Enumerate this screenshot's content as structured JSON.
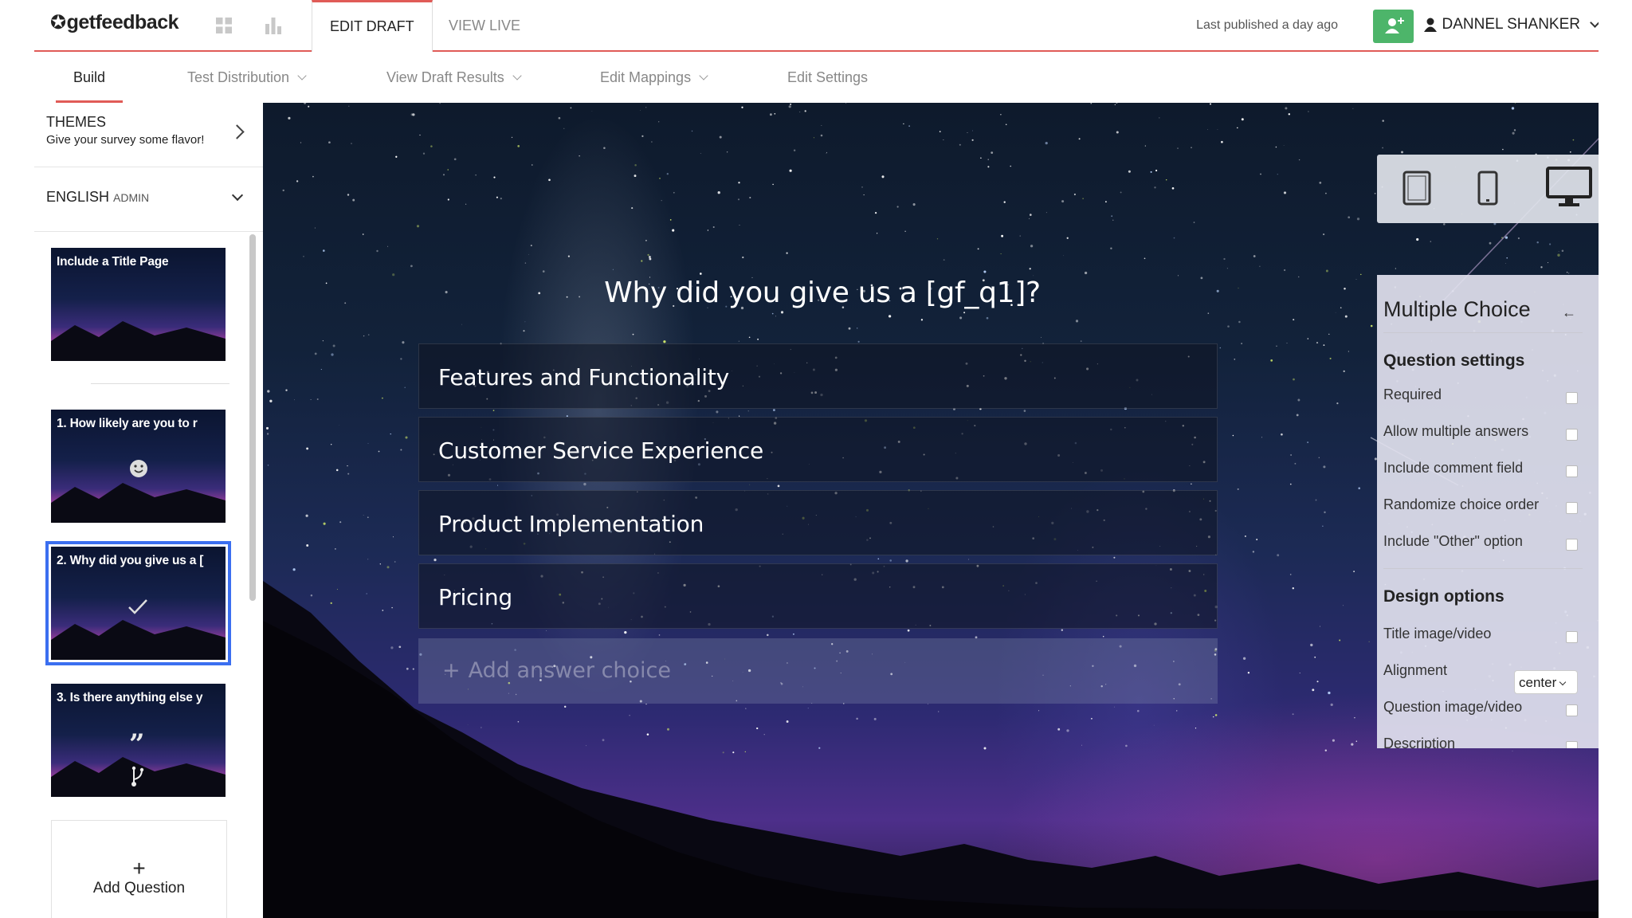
{
  "brand": {
    "logo_text": "getfeedback"
  },
  "topbar": {
    "tabs": [
      {
        "label": "EDIT DRAFT",
        "active": true
      },
      {
        "label": "VIEW LIVE",
        "active": false
      }
    ],
    "published_text": "Last published a day ago",
    "user_name": "DANNEL SHANKER",
    "accent_color": "#e05b57",
    "add_user_color": "#4db56a"
  },
  "subnav": {
    "tabs": [
      {
        "label": "Build",
        "active": true
      },
      {
        "label": "Test Distribution",
        "dropdown": true
      },
      {
        "label": "View Draft Results",
        "dropdown": true
      },
      {
        "label": "Edit Mappings",
        "dropdown": true
      },
      {
        "label": "Edit Settings",
        "dropdown": false
      }
    ]
  },
  "sidebar": {
    "themes": {
      "title": "THEMES",
      "subtitle": "Give your survey some flavor!"
    },
    "language": {
      "name": "ENGLISH",
      "role": "ADMIN"
    },
    "pages": [
      {
        "label": "Include a Title Page",
        "icon": "none"
      },
      {
        "label": "1. How likely are you to r",
        "icon": "smiley-icon"
      },
      {
        "label": "2. Why did you give us a [",
        "icon": "checkmark-icon",
        "selected": true
      },
      {
        "label": "3. Is there anything else y",
        "icon": "quote-icon",
        "branch": "branch-icon"
      }
    ],
    "add_question": {
      "plus": "+",
      "label": "Add Question"
    },
    "selected_color": "#3b6ff0"
  },
  "canvas": {
    "question": "Why did you give us a [gf_q1]?",
    "choices": [
      "Features and Functionality",
      "Customer Service Experience",
      "Product Implementation",
      "Pricing"
    ],
    "add_choice_label": "Add answer choice"
  },
  "devices": [
    "tablet-icon",
    "phone-icon",
    "desktop-icon"
  ],
  "panel": {
    "title": "Multiple Choice",
    "question_settings_title": "Question settings",
    "question_settings": [
      "Required",
      "Allow multiple answers",
      "Include comment field",
      "Randomize choice order",
      "Include \"Other\" option"
    ],
    "design_options_title": "Design options",
    "design_options": {
      "title_media": "Title image/video",
      "alignment_label": "Alignment",
      "alignment_value": "center",
      "question_media": "Question image/video",
      "description": "Description"
    }
  }
}
